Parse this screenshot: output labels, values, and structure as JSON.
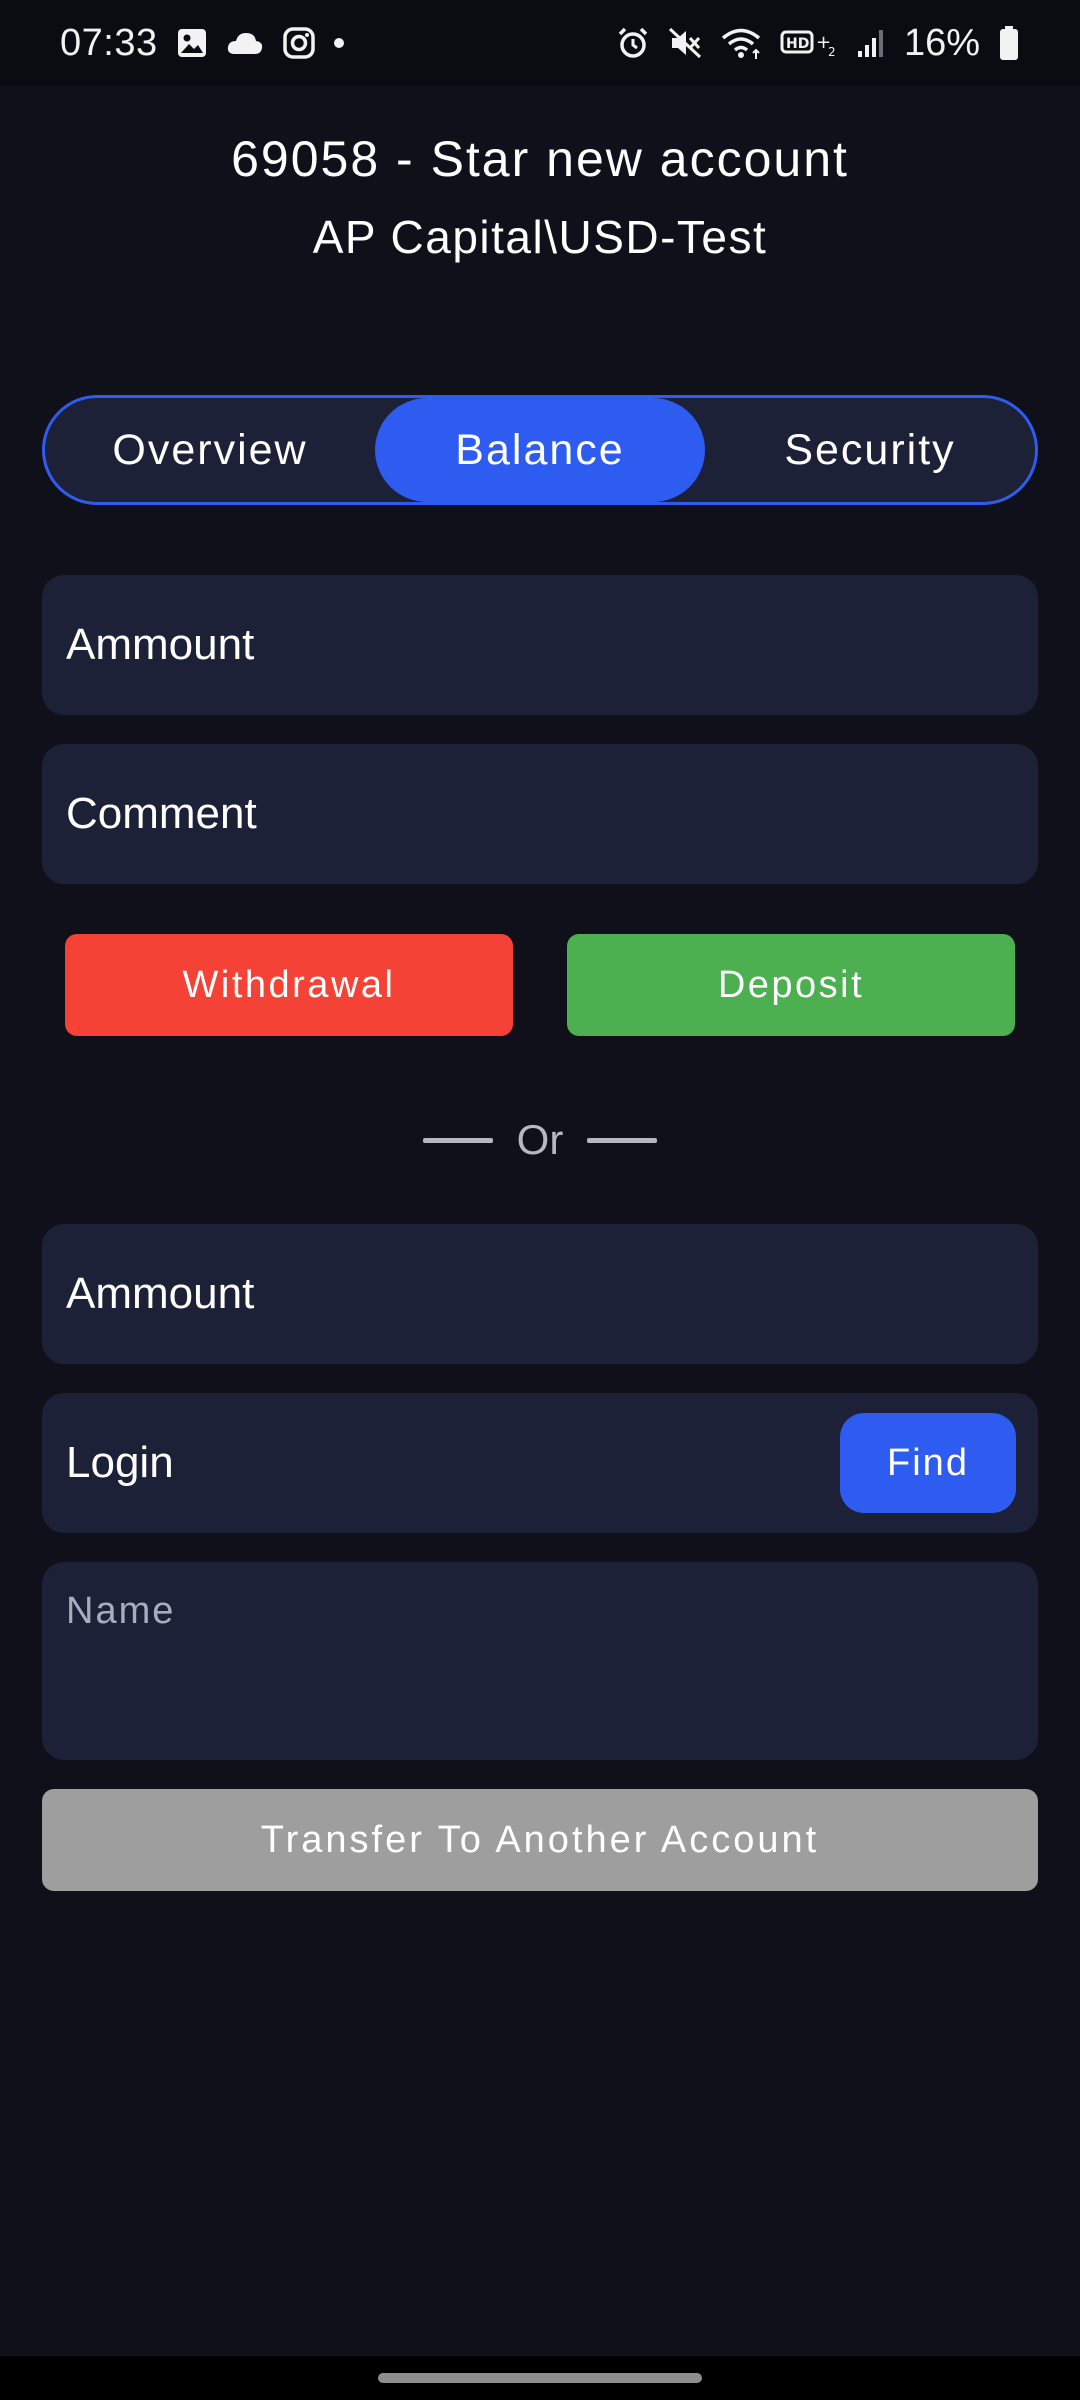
{
  "status_bar": {
    "time": "07:33",
    "battery": "16%",
    "icons": [
      "gallery-icon",
      "cloud-icon",
      "instagram-icon",
      "notification-dot-icon",
      "alarm-icon",
      "mute-icon",
      "wifi-icon",
      "hd-volte-icon",
      "signal-icon",
      "battery-icon"
    ]
  },
  "header": {
    "title": "69058 - Star new account",
    "subtitle": "AP Capital\\USD-Test"
  },
  "tabs": [
    {
      "label": "Overview",
      "active": false
    },
    {
      "label": "Balance",
      "active": true
    },
    {
      "label": "Security",
      "active": false
    }
  ],
  "balance_form": {
    "amount_placeholder": "Ammount",
    "comment_placeholder": "Comment",
    "withdrawal_label": "Withdrawal",
    "deposit_label": "Deposit"
  },
  "divider": {
    "text": "Or"
  },
  "transfer_form": {
    "amount_placeholder": "Ammount",
    "login_placeholder": "Login",
    "find_label": "Find",
    "name_placeholder": "Name",
    "transfer_label": "Transfer To Another Account"
  },
  "colors": {
    "background": "#0f1019",
    "field": "#1c2138",
    "accent": "#2f5cf0",
    "withdrawal": "#f44336",
    "deposit": "#4caf50",
    "disabled": "#9e9e9e"
  }
}
